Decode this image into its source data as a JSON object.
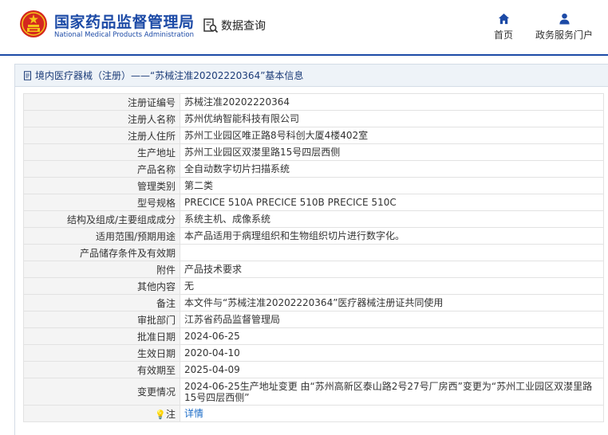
{
  "header": {
    "brand_cn": "国家药品监督管理局",
    "brand_en": "National Medical Products Administration",
    "query_label": "数据查询",
    "nav": [
      {
        "label": "首页",
        "icon": "home-icon"
      },
      {
        "label": "政务服务门户",
        "icon": "user-icon"
      }
    ]
  },
  "panel": {
    "title": "境内医疗器械（注册）——“苏械注准20202220364”基本信息"
  },
  "rows": [
    {
      "label": "注册证编号",
      "value": "苏械注准20202220364"
    },
    {
      "label": "注册人名称",
      "value": "苏州优纳智能科技有限公司"
    },
    {
      "label": "注册人住所",
      "value": "苏州工业园区唯正路8号科创大厦4楼402室"
    },
    {
      "label": "生产地址",
      "value": "苏州工业园区双漤里路15号四层西侧"
    },
    {
      "label": "产品名称",
      "value": "全自动数字切片扫描系统"
    },
    {
      "label": "管理类别",
      "value": "第二类"
    },
    {
      "label": "型号规格",
      "value": "PRECICE 510A PRECICE 510B PRECICE 510C"
    },
    {
      "label": "结构及组成/主要组成成分",
      "value": "系统主机、成像系统"
    },
    {
      "label": "适用范围/预期用途",
      "value": "本产品适用于病理组织和生物组织切片进行数字化。"
    },
    {
      "label": "产品储存条件及有效期",
      "value": ""
    },
    {
      "label": "附件",
      "value": "产品技术要求"
    },
    {
      "label": "其他内容",
      "value": "无"
    },
    {
      "label": "备注",
      "value": "本文件与“苏械注准20202220364”医疗器械注册证共同使用"
    },
    {
      "label": "审批部门",
      "value": "江苏省药品监督管理局"
    },
    {
      "label": "批准日期",
      "value": "2024-06-25"
    },
    {
      "label": "生效日期",
      "value": "2020-04-10"
    },
    {
      "label": "有效期至",
      "value": "2025-04-09"
    },
    {
      "label": "变更情况",
      "value": "2024-06-25生产地址变更 由“苏州高新区泰山路2号27号厂房西”变更为“苏州工业园区双漤里路15号四层西侧”"
    }
  ],
  "notes": {
    "label": "注",
    "link": "详情"
  },
  "colors": {
    "brand": "#1c4aa6",
    "link": "#1c6cc7",
    "label_bg": "#f4f4f4",
    "title_bg": "#eef3f8"
  }
}
